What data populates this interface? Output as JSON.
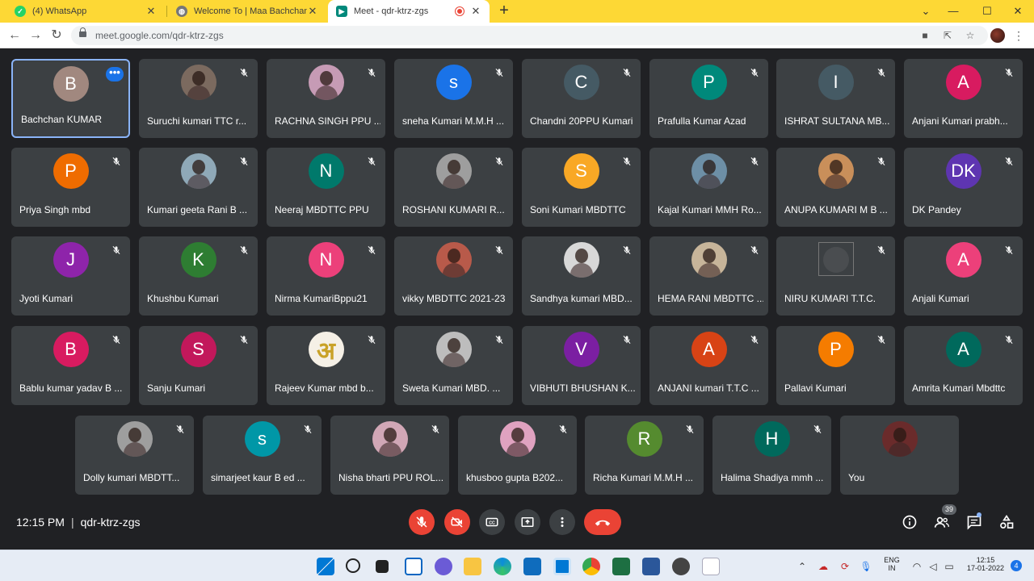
{
  "browser": {
    "tabs": [
      {
        "title": "(4) WhatsApp",
        "favicon_color": "#25d366"
      },
      {
        "title": "Welcome To | Maa Bachchan Dev",
        "favicon_color": "#777777"
      },
      {
        "title": "Meet - qdr-ktrz-zgs",
        "favicon_color": "#00897b"
      }
    ],
    "url": "meet.google.com/qdr-ktrz-zgs",
    "new_tab_label": "+",
    "recording_indicator_color": "#ea4335"
  },
  "participants": [
    {
      "name": "Bachchan KUMAR",
      "initial": "B",
      "color": "#a1887f",
      "type": "letter",
      "self": true
    },
    {
      "name": "Suruchi kumari TTC r...",
      "initial": "",
      "color": "#7b6a5f",
      "type": "photo"
    },
    {
      "name": "RACHNA SINGH PPU ...",
      "initial": "",
      "color": "#c69bb5",
      "type": "photo"
    },
    {
      "name": "sneha Kumari M.M.H ...",
      "initial": "s",
      "color": "#1a73e8",
      "type": "letter"
    },
    {
      "name": "Chandni 20PPU Kumari",
      "initial": "C",
      "color": "#455a64",
      "type": "letter"
    },
    {
      "name": "Prafulla Kumar Azad",
      "initial": "P",
      "color": "#00897b",
      "type": "letter"
    },
    {
      "name": "ISHRAT SULTANA MB...",
      "initial": "I",
      "color": "#455a64",
      "type": "letter"
    },
    {
      "name": "Anjani Kumari prabh...",
      "initial": "A",
      "color": "#d81b60",
      "type": "letter"
    },
    {
      "name": "Priya Singh mbd",
      "initial": "P",
      "color": "#ef6c00",
      "type": "letter"
    },
    {
      "name": "Kumari geeta Rani B ...",
      "initial": "",
      "color": "#8fa9b8",
      "type": "photo"
    },
    {
      "name": "Neeraj MBDTTC PPU",
      "initial": "N",
      "color": "#00796b",
      "type": "letter"
    },
    {
      "name": "ROSHANI KUMARI R...",
      "initial": "",
      "color": "#9e9e9e",
      "type": "photo"
    },
    {
      "name": "Soni Kumari MBDTTC",
      "initial": "S",
      "color": "#f9a825",
      "type": "letter"
    },
    {
      "name": "Kajal Kumari MMH Ro...",
      "initial": "",
      "color": "#6d8fa6",
      "type": "photo"
    },
    {
      "name": "ANUPA KUMARI M B ...",
      "initial": "",
      "color": "#c98f5a",
      "type": "photo"
    },
    {
      "name": "DK Pandey",
      "initial": "DK",
      "color": "#5e35b1",
      "type": "letter"
    },
    {
      "name": "Jyoti Kumari",
      "initial": "J",
      "color": "#8e24aa",
      "type": "letter"
    },
    {
      "name": "Khushbu Kumari",
      "initial": "K",
      "color": "#2e7d32",
      "type": "letter"
    },
    {
      "name": "Nirma KumariBppu21",
      "initial": "N",
      "color": "#ec407a",
      "type": "letter"
    },
    {
      "name": "vikky MBDTTC 2021-23",
      "initial": "",
      "color": "#b85a4a",
      "type": "photo"
    },
    {
      "name": "Sandhya kumari MBD...",
      "initial": "",
      "color": "#d8d8d8",
      "type": "photo"
    },
    {
      "name": "HEMA RANI MBDTTC ...",
      "initial": "",
      "color": "#c7b59a",
      "type": "photo"
    },
    {
      "name": "NIRU KUMARI T.T.C.",
      "initial": "",
      "color": "#4a4d50",
      "type": "broken"
    },
    {
      "name": "Anjali Kumari",
      "initial": "A",
      "color": "#ec407a",
      "type": "letter"
    },
    {
      "name": "Bablu kumar yadav B ...",
      "initial": "B",
      "color": "#d81b60",
      "type": "letter"
    },
    {
      "name": "Sanju Kumari",
      "initial": "S",
      "color": "#c2185b",
      "type": "letter"
    },
    {
      "name": "Rajeev Kumar mbd b...",
      "initial": "अ",
      "color": "#f5f0e6",
      "type": "photo-letter"
    },
    {
      "name": "Sweta Kumari MBD. ...",
      "initial": "",
      "color": "#bdbdbd",
      "type": "photo"
    },
    {
      "name": "VIBHUTI BHUSHAN K...",
      "initial": "V",
      "color": "#7b1fa2",
      "type": "letter"
    },
    {
      "name": "ANJANI kumari T.T.C ...",
      "initial": "A",
      "color": "#d84315",
      "type": "letter"
    },
    {
      "name": "Pallavi Kumari",
      "initial": "P",
      "color": "#f57c00",
      "type": "letter"
    },
    {
      "name": "Amrita Kumari Mbdttc",
      "initial": "A",
      "color": "#00695c",
      "type": "letter"
    },
    {
      "name": "Dolly kumari MBDTT...",
      "initial": "",
      "color": "#9e9e9e",
      "type": "photo"
    },
    {
      "name": "simarjeet kaur B ed ...",
      "initial": "s",
      "color": "#0097a7",
      "type": "letter"
    },
    {
      "name": "Nisha bharti PPU ROL...",
      "initial": "",
      "color": "#d1a7b6",
      "type": "photo"
    },
    {
      "name": "khusboo gupta B202...",
      "initial": "",
      "color": "#e0a2c0",
      "type": "photo"
    },
    {
      "name": "Richa Kumari M.M.H ...",
      "initial": "R",
      "color": "#558b2f",
      "type": "letter"
    },
    {
      "name": "Halima Shadiya mmh ...",
      "initial": "H",
      "color": "#00695c",
      "type": "letter"
    },
    {
      "name": "You",
      "initial": "",
      "color": "#6a2b2b",
      "type": "photo",
      "no_mic": true
    }
  ],
  "bottom_bar": {
    "time": "12:15 PM",
    "separator": "|",
    "meeting_code": "qdr-ktrz-zgs",
    "participant_count": "39"
  },
  "taskbar": {
    "lang": "ENG",
    "region": "IN",
    "clock_time": "12:15",
    "clock_date": "17-01-2022",
    "notification_count": "4"
  }
}
